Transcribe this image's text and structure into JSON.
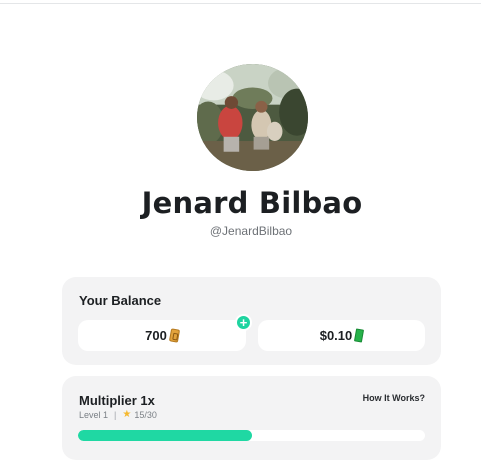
{
  "profile": {
    "name": "Jenard Bilbao",
    "handle": "@JenardBilbao",
    "avatar_icon": "profile-photo"
  },
  "balance": {
    "title": "Your Balance",
    "coins": "700",
    "coin_icon": "gold-ticket-icon",
    "cash": "$0.10",
    "cash_icon": "cash-bill-icon",
    "add_icon": "plus-icon"
  },
  "multiplier": {
    "title": "Multiplier 1x",
    "how_link": "How It Works?",
    "level": "Level 1",
    "separator": "|",
    "xp": "15/30",
    "progress": 0.5
  },
  "colors": {
    "accent": "#1fd8a3",
    "card_bg": "#f3f3f4",
    "star": "#f5b82e"
  }
}
